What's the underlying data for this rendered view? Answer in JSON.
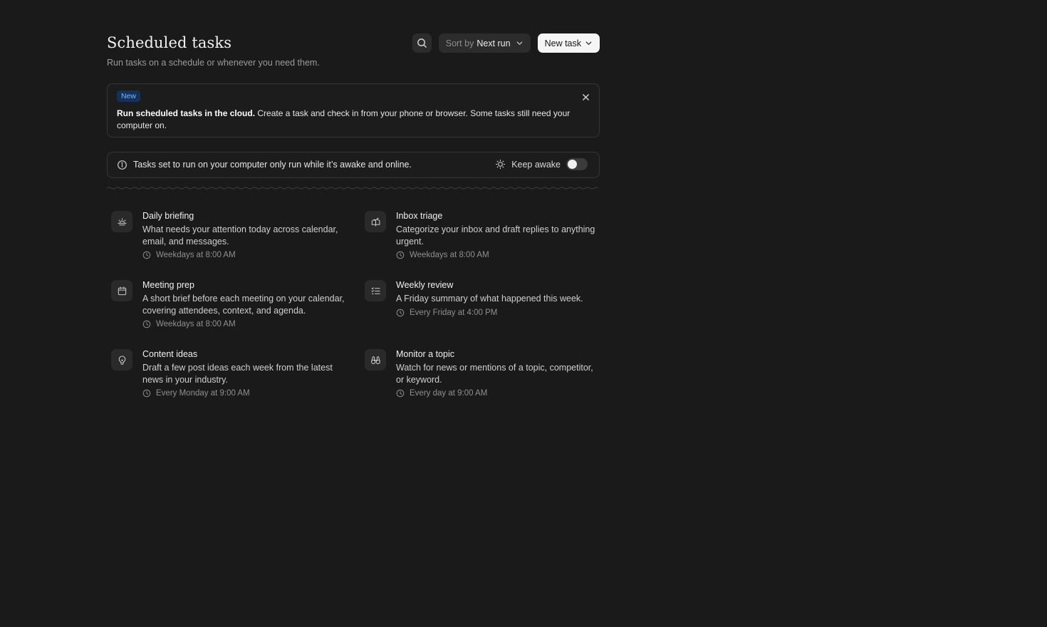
{
  "header": {
    "title": "Scheduled tasks",
    "subtitle": "Run tasks on a schedule or whenever you need them.",
    "sort_label": "Sort by",
    "sort_value": "Next run",
    "new_task_label": "New task",
    "search_icon": "search-icon"
  },
  "banner": {
    "badge": "New",
    "bold_text": "Run scheduled tasks in the cloud.",
    "text": " Create a task and check in from your phone or browser. Some tasks still need your computer on."
  },
  "notice": {
    "text": "Tasks set to run on your computer only run while it’s awake and online.",
    "keep_awake_label": "Keep awake",
    "keep_awake_on": false
  },
  "tasks": [
    {
      "name": "Daily briefing",
      "description": "What needs your attention today across calendar, email, and messages.",
      "schedule": "Weekdays at 8:00 AM",
      "icon": "sunrise-icon"
    },
    {
      "name": "Inbox triage",
      "description": "Categorize your inbox and draft replies to anything urgent.",
      "schedule": "Weekdays at 8:00 AM",
      "icon": "mailbox-icon"
    },
    {
      "name": "Meeting prep",
      "description": "A short brief before each meeting on your calendar, covering attendees, context, and agenda.",
      "schedule": "Weekdays at 8:00 AM",
      "icon": "calendar-icon"
    },
    {
      "name": "Weekly review",
      "description": "A Friday summary of what happened this week.",
      "schedule": "Every Friday at 4:00 PM",
      "icon": "checklist-icon"
    },
    {
      "name": "Content ideas",
      "description": "Draft a few post ideas each week from the latest news in your industry.",
      "schedule": "Every Monday at 9:00 AM",
      "icon": "lightbulb-icon"
    },
    {
      "name": "Monitor a topic",
      "description": "Watch for news or mentions of a topic, competitor, or keyword.",
      "schedule": "Every day at 9:00 AM",
      "icon": "binoculars-icon"
    }
  ]
}
